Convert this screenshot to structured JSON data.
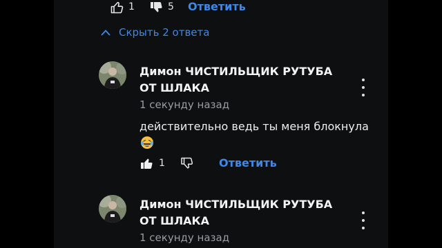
{
  "top_actions": {
    "likes": "1",
    "dislikes": "5",
    "reply_label": "Ответить"
  },
  "collapse_label": "Скрыть 2 ответа",
  "replies": [
    {
      "author": "Димон ЧИСТИЛЬЩИК РУТУБА ОТ ШЛАКА",
      "time": "1 секунду назад",
      "text": "действительно ведь ты меня блокнула",
      "emoji": "laughing-tears-emoji",
      "likes": "1",
      "reply_label": "Ответить"
    },
    {
      "author": "Димон ЧИСТИЛЬЩИК РУТУБА ОТ ШЛАКА",
      "time": "1 секунду назад"
    }
  ],
  "colors": {
    "accent": "#3f88e8",
    "panel": "#0e0f11",
    "muted": "#9a9ca0"
  }
}
